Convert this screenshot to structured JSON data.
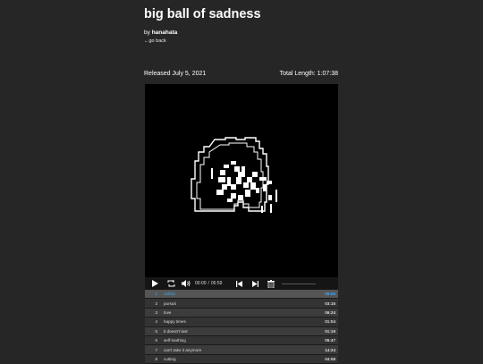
{
  "album": {
    "title": "big ball of sadness",
    "by_prefix": "by",
    "artist": "hanahata",
    "back_link": "←go back",
    "released": "Released July 5, 2021",
    "total_length": "Total Length: 1:07:38"
  },
  "player": {
    "current_time": "00:00",
    "separator": "/",
    "duration": "05:59",
    "progress": 0.0,
    "icons": [
      "play-icon",
      "repeat-icon",
      "volume-icon",
      "previous-icon",
      "next-icon",
      "trash-icon"
    ]
  },
  "tracks": [
    {
      "num": "1",
      "name": "nothol",
      "dur": "05:59",
      "active": true
    },
    {
      "num": "2",
      "name": "pursuit",
      "dur": "03:15",
      "active": false
    },
    {
      "num": "3",
      "name": "love",
      "dur": "06:24",
      "active": false
    },
    {
      "num": "4",
      "name": "happy times",
      "dur": "01:04",
      "active": false
    },
    {
      "num": "5",
      "name": "it doesn't last",
      "dur": "01:19",
      "active": false
    },
    {
      "num": "6",
      "name": "self-loathing",
      "dur": "05:47",
      "active": false
    },
    {
      "num": "7",
      "name": "can't take it anymore",
      "dur": "14:24",
      "active": false
    },
    {
      "num": "8",
      "name": "cutting",
      "dur": "04:08",
      "active": false
    }
  ],
  "colors": {
    "background": "#262626",
    "active_track": "#33aaff"
  }
}
